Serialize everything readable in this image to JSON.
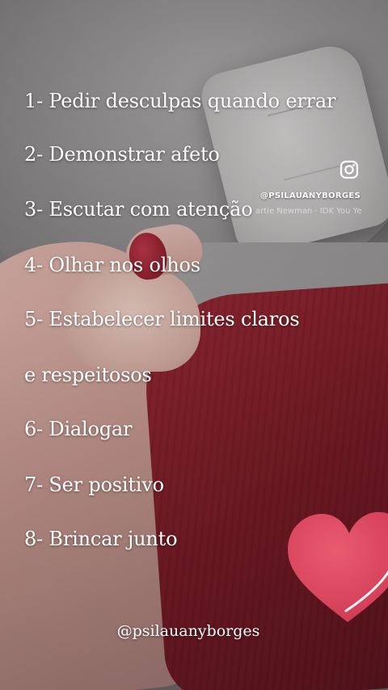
{
  "list": {
    "items": [
      "1- Pedir desculpas quando errar",
      "2- Demonstrar afeto",
      "3- Escutar com atenção",
      "4- Olhar nos olhos",
      "5- Estabelecer limites claros",
      "e respeitosos",
      "6- Dialogar",
      "7- Ser positivo",
      "8- Brincar junto"
    ]
  },
  "overlay": {
    "instagram_icon": "instagram-icon",
    "instagram_handle": "@PSILAUANYBORGES",
    "music_tag": "artie Newman · IDK You Ye"
  },
  "sticker": {
    "icon": "heart-icon",
    "color": "#e0455c"
  },
  "footer": {
    "handle": "@psilauanyborges"
  }
}
